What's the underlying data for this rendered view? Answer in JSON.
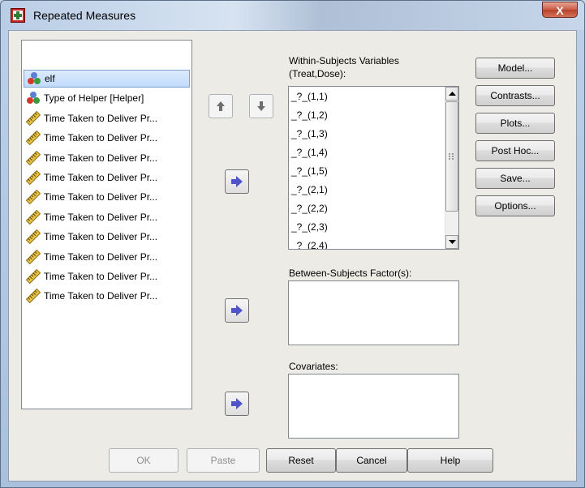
{
  "window": {
    "title": "Repeated Measures",
    "close_label": "X"
  },
  "colors": {
    "selection": "#c1dbfc",
    "move_arrow": "#4f55c8"
  },
  "variables": [
    {
      "label": "elf",
      "icon": "nominal-variable-icon",
      "selected": true
    },
    {
      "label": "Type of Helper [Helper]",
      "icon": "nominal-variable-icon",
      "selected": false
    },
    {
      "label": "Time Taken to Deliver Pr...",
      "icon": "scale-variable-icon",
      "selected": false
    },
    {
      "label": "Time Taken to Deliver Pr...",
      "icon": "scale-variable-icon",
      "selected": false
    },
    {
      "label": "Time Taken to Deliver Pr...",
      "icon": "scale-variable-icon",
      "selected": false
    },
    {
      "label": "Time Taken to Deliver Pr...",
      "icon": "scale-variable-icon",
      "selected": false
    },
    {
      "label": "Time Taken to Deliver Pr...",
      "icon": "scale-variable-icon",
      "selected": false
    },
    {
      "label": "Time Taken to Deliver Pr...",
      "icon": "scale-variable-icon",
      "selected": false
    },
    {
      "label": "Time Taken to Deliver Pr...",
      "icon": "scale-variable-icon",
      "selected": false
    },
    {
      "label": "Time Taken to Deliver Pr...",
      "icon": "scale-variable-icon",
      "selected": false
    },
    {
      "label": "Time Taken to Deliver Pr...",
      "icon": "scale-variable-icon",
      "selected": false
    },
    {
      "label": "Time Taken to Deliver Pr...",
      "icon": "scale-variable-icon",
      "selected": false
    }
  ],
  "within": {
    "label_line1": "Within-Subjects Variables",
    "label_line2": "(Treat,Dose):",
    "items": [
      "_?_(1,1)",
      "_?_(1,2)",
      "_?_(1,3)",
      "_?_(1,4)",
      "_?_(1,5)",
      "_?_(2,1)",
      "_?_(2,2)",
      "_?_(2,3)",
      "_?_(2,4)"
    ]
  },
  "between": {
    "label": "Between-Subjects Factor(s):"
  },
  "covariates": {
    "label": "Covariates:"
  },
  "side_buttons": [
    "Model...",
    "Contrasts...",
    "Plots...",
    "Post Hoc...",
    "Save...",
    "Options..."
  ],
  "bottom_buttons": {
    "ok": "OK",
    "paste": "Paste",
    "reset": "Reset",
    "cancel": "Cancel",
    "help": "Help"
  }
}
